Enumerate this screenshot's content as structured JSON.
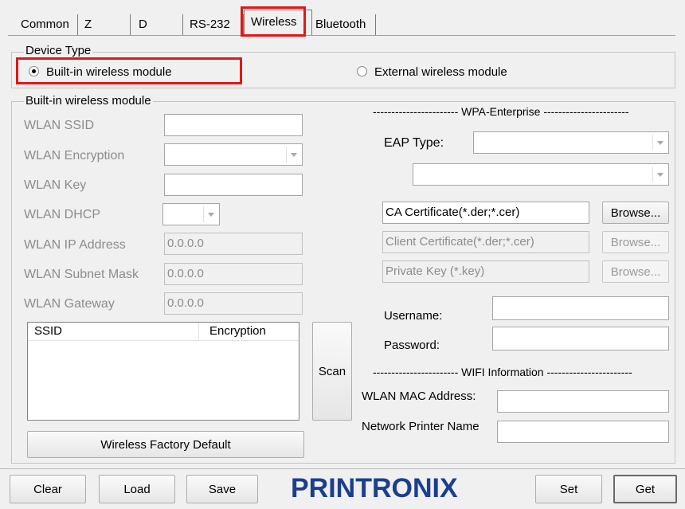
{
  "tabs": [
    "Common",
    "Z",
    "D",
    "RS-232",
    "Wireless",
    "Bluetooth"
  ],
  "device_type": {
    "title": "Device Type",
    "builtin_label": "Built-in wireless module",
    "external_label": "External wireless module",
    "selected": "Built-in wireless module"
  },
  "builtin_group": {
    "title": "Built-in wireless module",
    "ssid_label": "WLAN SSID",
    "ssid_value": "",
    "encryption_label": "WLAN Encryption",
    "encryption_value": "",
    "key_label": "WLAN Key",
    "key_value": "",
    "dhcp_label": "WLAN DHCP",
    "dhcp_value": "",
    "ip_label": "WLAN IP Address",
    "ip_value": "0.0.0.0",
    "mask_label": "WLAN Subnet Mask",
    "mask_value": "0.0.0.0",
    "gateway_label": "WLAN Gateway",
    "gateway_value": "0.0.0.0",
    "list_headers": [
      "SSID",
      "Encryption"
    ],
    "scan_label": "Scan",
    "factory_default_label": "Wireless Factory Default"
  },
  "wpa": {
    "heading": "----------------------- WPA-Enterprise -----------------------",
    "eap_label": "EAP Type:",
    "eap_value": "",
    "eap_sub_value": "",
    "ca_value": "CA Certificate(*.der;*.cer)",
    "client_value": "Client Certificate(*.der;*.cer)",
    "private_value": "Private Key (*.key)",
    "browse_label": "Browse...",
    "username_label": "Username:",
    "username_value": "",
    "password_label": "Password:",
    "password_value": ""
  },
  "wifi": {
    "heading": "----------------------- WIFI Information -----------------------",
    "mac_label": "WLAN MAC Address:",
    "mac_value": "",
    "printer_label": "Network Printer Name",
    "printer_value": ""
  },
  "bottom": {
    "clear": "Clear",
    "load": "Load",
    "save": "Save",
    "logo": "PRINTRONIX",
    "set": "Set",
    "get": "Get"
  },
  "colors": {
    "logo": "#1b3f8f",
    "highlight": "#e01818"
  }
}
